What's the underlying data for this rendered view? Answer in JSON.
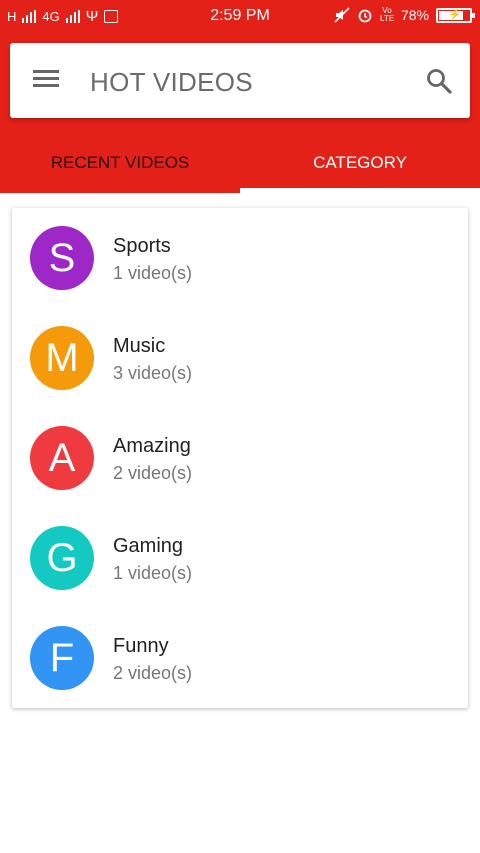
{
  "status_bar": {
    "network_left": "H",
    "network_4g": "4G",
    "time": "2:59 PM",
    "volte": "Vo LTE",
    "battery_percent": "78%",
    "battery_level": 0.78
  },
  "header": {
    "title": "HOT VIDEOS",
    "menu_icon": "hamburger-menu-icon",
    "search_icon": "search-icon"
  },
  "tabs": [
    {
      "label": "RECENT VIDEOS",
      "selected": false
    },
    {
      "label": "CATEGORY",
      "selected": true
    }
  ],
  "colors": {
    "primary": "#e32119",
    "tab_inactive_text": "#2b0f0c"
  },
  "categories": [
    {
      "letter": "S",
      "name": "Sports",
      "count": "1 video(s)",
      "color": "#9e27c7"
    },
    {
      "letter": "M",
      "name": "Music",
      "count": "3 video(s)",
      "color": "#f59a0a"
    },
    {
      "letter": "A",
      "name": "Amazing",
      "count": "2 video(s)",
      "color": "#ef3a3f"
    },
    {
      "letter": "G",
      "name": "Gaming",
      "count": "1 video(s)",
      "color": "#14c9c1"
    },
    {
      "letter": "F",
      "name": "Funny",
      "count": "2 video(s)",
      "color": "#3294f5"
    }
  ]
}
